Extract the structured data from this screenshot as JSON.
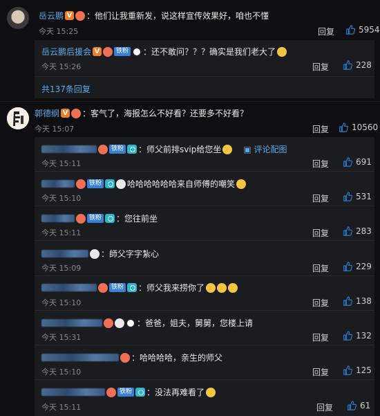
{
  "reply_label": "回复",
  "thumb_icon": "thumbs-up-icon",
  "top_comment": {
    "username": "岳云鹏",
    "text": "：他们让我重新发，说这样宣传效果好，咱也不懂",
    "time": "今天 15:25",
    "likes": "5954"
  },
  "first_reply": {
    "username": "岳云鹏后援会",
    "text": "：还不敢问？？？确实是我们老大了",
    "time": "今天 15:26",
    "likes": "228"
  },
  "more_replies": "共137条回复",
  "second_comment": {
    "username": "郭德纲",
    "text": "：客气了，海报怎么不好看？还要多不好看？",
    "time": "今天 15:07",
    "likes": "10560"
  },
  "badge_tiefen": "铁粉",
  "pic_link": "评论配图",
  "replies": [
    {
      "text": "：师父前排svip给您坐",
      "time": "今天 15:11",
      "likes": "691"
    },
    {
      "text": "哈哈哈哈哈哈来自师傅的嘲笑",
      "time": "今天 15:10",
      "likes": "531"
    },
    {
      "text": "：您往前坐",
      "time": "今天 15:11",
      "likes": "283"
    },
    {
      "text": "：師父字字紮心",
      "time": "今天 15:09",
      "likes": "229"
    },
    {
      "text": "：师父我来捞你了",
      "time": "今天 15:10",
      "likes": "138"
    },
    {
      "text": "：爸爸，姐夫，舅舅，您楼上请",
      "time": "今天 15:31",
      "likes": "132"
    },
    {
      "text": "：哈哈哈哈，亲生的师父",
      "time": "今天 15:10",
      "likes": "125"
    },
    {
      "text": "：没法再难看了",
      "time": "今天 15:11",
      "likes": "61"
    }
  ]
}
